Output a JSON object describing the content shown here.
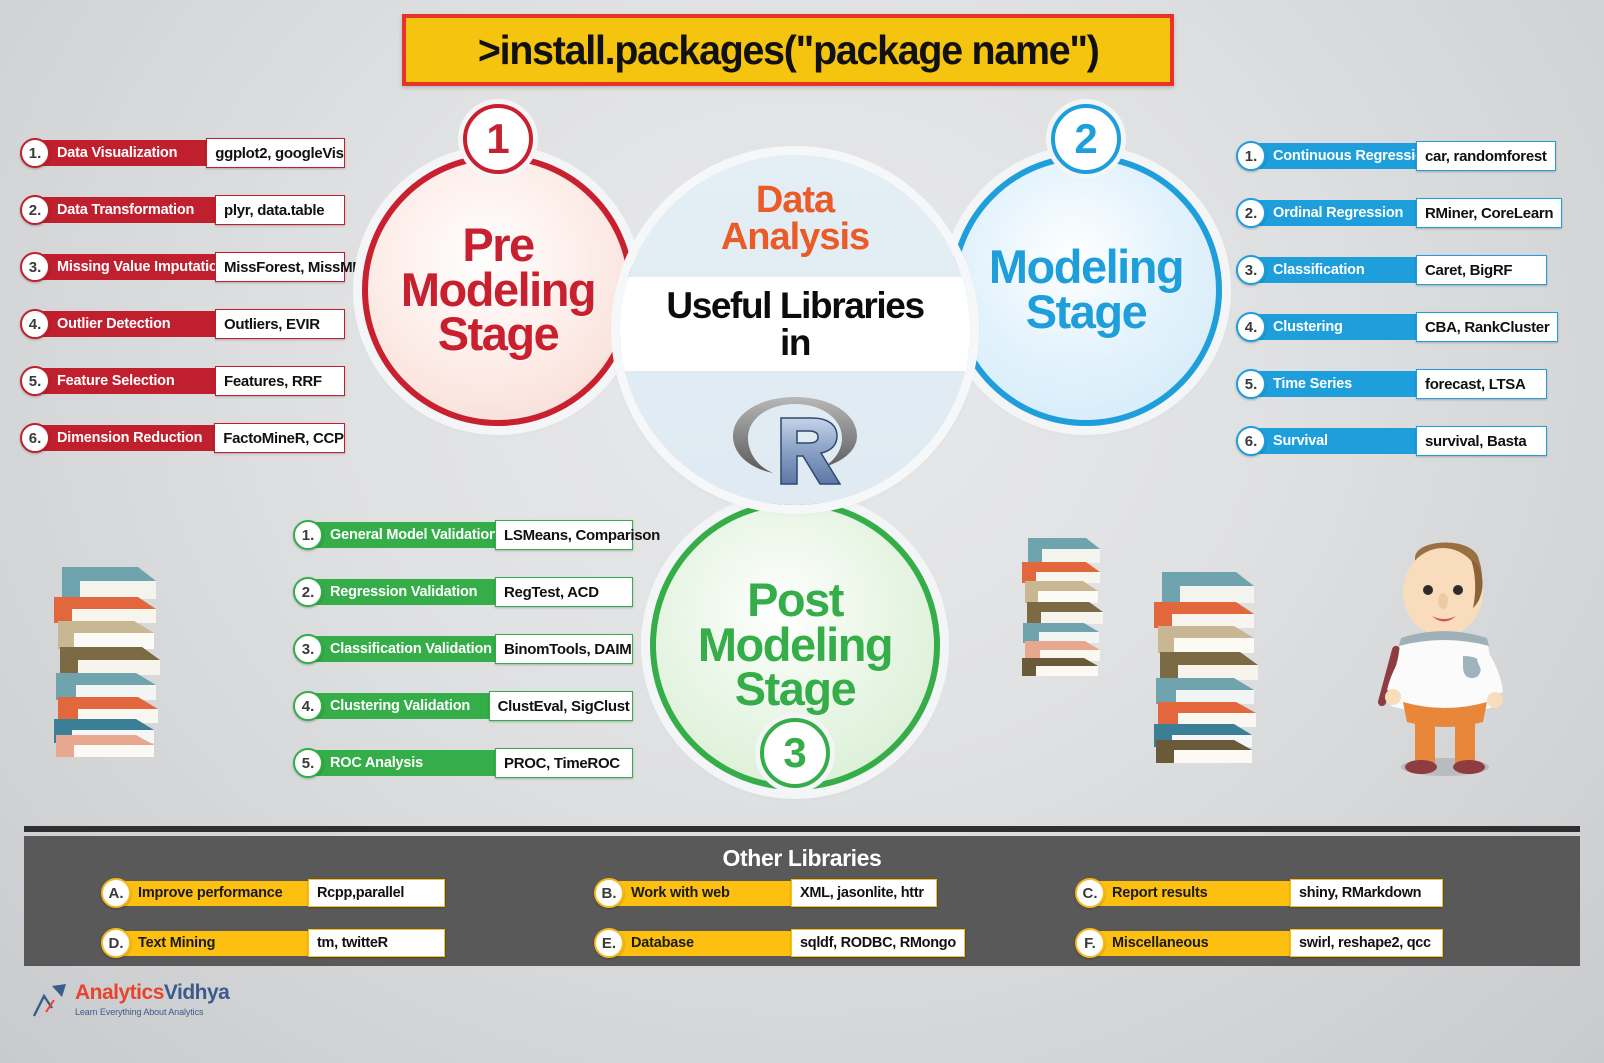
{
  "header": {
    "command": ">install.packages(\"package name\")"
  },
  "center": {
    "title_line1": "Data",
    "title_line2": "Analysis",
    "subtitle_line1": "Useful Libraries",
    "subtitle_line2": "in",
    "logo_icon": "r-language-logo"
  },
  "stages": {
    "pre": {
      "badge": "1",
      "line1": "Pre",
      "line2": "Modeling",
      "line3": "Stage",
      "color": "#c8202e"
    },
    "modeling": {
      "badge": "2",
      "line1": "Modeling",
      "line2": "Stage",
      "color": "#1e9fdb"
    },
    "post": {
      "badge": "3",
      "line1": "Post",
      "line2": "Modeling",
      "line3": "Stage",
      "color": "#35ad48"
    }
  },
  "pre_modeling": {
    "items": [
      {
        "num": "1.",
        "label": "Data Visualization",
        "packages": "ggplot2, googleVis"
      },
      {
        "num": "2.",
        "label": "Data Transformation",
        "packages": "plyr, data.table"
      },
      {
        "num": "3.",
        "label": "Missing Value Imputations",
        "packages": "MissForest, MissMDA"
      },
      {
        "num": "4.",
        "label": "Outlier Detection",
        "packages": "Outliers, EVIR"
      },
      {
        "num": "5.",
        "label": "Feature Selection",
        "packages": "Features, RRF"
      },
      {
        "num": "6.",
        "label": "Dimension Reduction",
        "packages": "FactoMineR, CCP"
      }
    ]
  },
  "modeling": {
    "items": [
      {
        "num": "1.",
        "label": "Continuous Regression",
        "packages": "car, randomforest"
      },
      {
        "num": "2.",
        "label": "Ordinal Regression",
        "packages": "RMiner, CoreLearn"
      },
      {
        "num": "3.",
        "label": "Classification",
        "packages": "Caret, BigRF"
      },
      {
        "num": "4.",
        "label": "Clustering",
        "packages": "CBA, RankCluster"
      },
      {
        "num": "5.",
        "label": "Time Series",
        "packages": "forecast, LTSA"
      },
      {
        "num": "6.",
        "label": "Survival",
        "packages": "survival, Basta"
      }
    ]
  },
  "post_modeling": {
    "items": [
      {
        "num": "1.",
        "label": "General Model Validation",
        "packages": "LSMeans, Comparison"
      },
      {
        "num": "2.",
        "label": "Regression Validation",
        "packages": "RegTest, ACD"
      },
      {
        "num": "3.",
        "label": "Classification Validation",
        "packages": "BinomTools, DAIM"
      },
      {
        "num": "4.",
        "label": "Clustering Validation",
        "packages": "ClustEval, SigClust"
      },
      {
        "num": "5.",
        "label": "ROC Analysis",
        "packages": "PROC, TimeROC"
      }
    ]
  },
  "other_libraries": {
    "title": "Other Libraries",
    "items": [
      {
        "key": "A",
        "num": "A.",
        "label": "Improve performance",
        "packages": "Rcpp,parallel"
      },
      {
        "key": "D",
        "num": "D.",
        "label": "Text Mining",
        "packages": "tm, twitteR"
      },
      {
        "key": "B",
        "num": "B.",
        "label": "Work with web",
        "packages": "XML, jasonlite, httr"
      },
      {
        "key": "E",
        "num": "E.",
        "label": "Database",
        "packages": "sqldf, RODBC, RMongo"
      },
      {
        "key": "C",
        "num": "C.",
        "label": "Report results",
        "packages": "shiny, RMarkdown"
      },
      {
        "key": "F",
        "num": "F.",
        "label": "Miscellaneous",
        "packages": "swirl, reshape2, qcc"
      }
    ]
  },
  "brand": {
    "name_part1": "Analytics",
    "name_part2": "Vidhya",
    "tagline": "Learn Everything About Analytics",
    "icon": "arrow-up-right-icon"
  },
  "decorations": {
    "book_stack": "book-stack-illustration",
    "teacher": "teacher-character-illustration"
  },
  "colors": {
    "banner_bg": "#f5c40f",
    "banner_border": "#e8332a",
    "red": "#c0202e",
    "blue": "#1e9fdb",
    "green": "#35ad48",
    "yellow": "#fdc010",
    "panel_bg": "#595959",
    "orange_text": "#ea5b28"
  }
}
